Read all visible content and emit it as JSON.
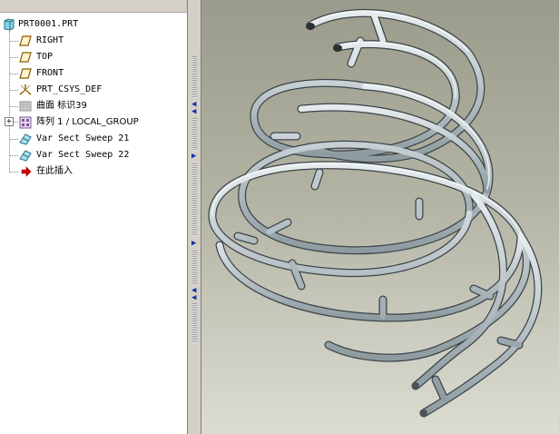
{
  "model_tree": {
    "root": "PRT0001.PRT",
    "items": [
      {
        "label": "RIGHT",
        "icon": "datum-plane-icon"
      },
      {
        "label": "TOP",
        "icon": "datum-plane-icon"
      },
      {
        "label": "FRONT",
        "icon": "datum-plane-icon"
      },
      {
        "label": "PRT_CSYS_DEF",
        "icon": "coordinate-system-icon"
      },
      {
        "label": "曲面 标识39",
        "icon": "surface-icon"
      },
      {
        "label": "阵列 1 / LOCAL_GROUP",
        "icon": "pattern-icon"
      },
      {
        "label": "Var Sect Sweep 21",
        "icon": "var-sect-sweep-icon"
      },
      {
        "label": "Var Sect Sweep 22",
        "icon": "var-sect-sweep-icon"
      },
      {
        "label": "在此插入",
        "icon": "insert-here-arrow-icon"
      }
    ]
  },
  "colors": {
    "accent_arrow": "#cc0000",
    "viewport_top": "#9b9b8b",
    "viewport_bottom": "#dcdcd2",
    "tube": "#b8c4c8"
  }
}
